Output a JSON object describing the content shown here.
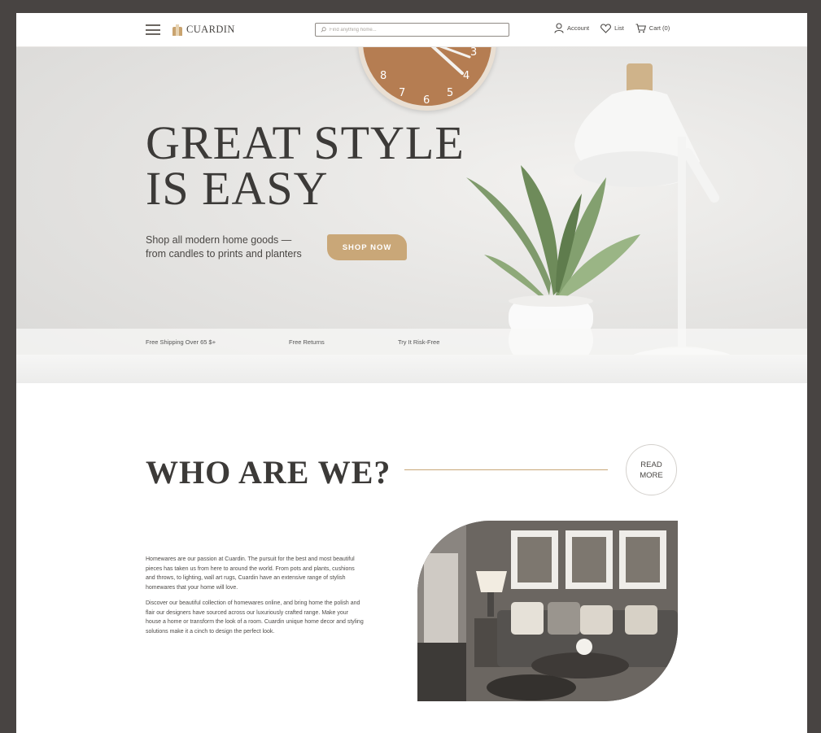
{
  "header": {
    "logo_text": "CUARDIN",
    "search_placeholder": "Find anything home...",
    "account_label": "Account",
    "list_label": "List",
    "cart_label": "Cart (0)"
  },
  "hero": {
    "title_line1": "Great Style",
    "title_line2": "is Easy",
    "subtitle_line1": "Shop all modern home goods —",
    "subtitle_line2": "from candles to prints and planters",
    "cta_label": "SHOP NOW",
    "perks": [
      "Free Shipping Over 65 $+",
      "Free Returns",
      "Try It Risk-Free"
    ]
  },
  "about": {
    "title": "WHO ARE WE?",
    "read_more_line1": "READ",
    "read_more_line2": "MORE",
    "paragraph1": "Homewares are our passion at Cuardin. The pursuit for the best and most beautiful pieces has taken us from here to around the world. From pots and plants, cushions and throws, to lighting, wall art rugs, Cuardin have an extensive range of stylish homewares that your home will love.",
    "paragraph2": "Discover our beautiful collection of homewares online, and bring home the polish and flair our designers have sourced across our luxuriously crafted range. Make your house a home or transform the look of a room. Cuardin unique home decor and styling solutions make it a cinch to design the perfect look."
  },
  "colors": {
    "accent": "#c9a778",
    "background_outer": "#484442",
    "text_dark": "#3c3a38"
  }
}
